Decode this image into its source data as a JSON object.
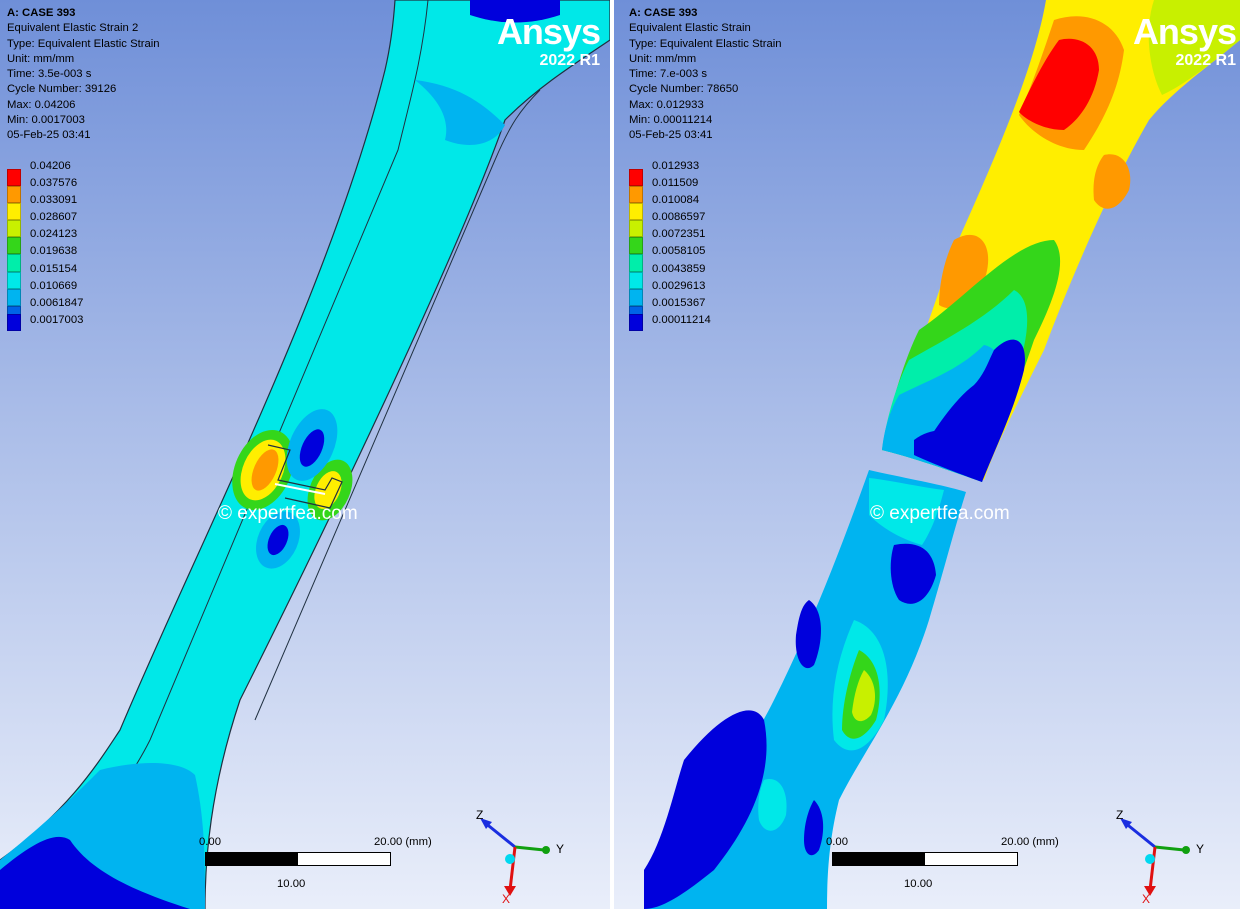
{
  "panels": [
    {
      "case": "A: CASE 393",
      "result_name": "Equivalent Elastic Strain 2",
      "type": "Type: Equivalent Elastic Strain",
      "unit": "Unit: mm/mm",
      "time": "Time: 3.5e-003 s",
      "cycle": "Cycle Number: 39126",
      "max": "Max: 0.04206",
      "min": "Min: 0.0017003",
      "date": "05-Feb-25 03:41",
      "legend": [
        "0.04206",
        "0.037576",
        "0.033091",
        "0.028607",
        "0.024123",
        "0.019638",
        "0.015154",
        "0.010669",
        "0.0061847",
        "0.0017003"
      ],
      "scale": {
        "left": "0.00",
        "right": "20.00 (mm)",
        "mid": "10.00"
      }
    },
    {
      "case": "A: CASE 393",
      "result_name": "Equivalent Elastic Strain",
      "type": "Type: Equivalent Elastic Strain",
      "unit": "Unit: mm/mm",
      "time": "Time: 7.e-003 s",
      "cycle": "Cycle Number: 78650",
      "max": "Max: 0.012933",
      "min": "Min: 0.00011214",
      "date": "05-Feb-25 03:41",
      "legend": [
        "0.012933",
        "0.011509",
        "0.010084",
        "0.0086597",
        "0.0072351",
        "0.0058105",
        "0.0043859",
        "0.0029613",
        "0.0015367",
        "0.00011214"
      ],
      "scale": {
        "left": "0.00",
        "right": "20.00 (mm)",
        "mid": "10.00"
      }
    }
  ],
  "legend_colors": [
    "#ff0000",
    "#ff9900",
    "#ffee00",
    "#c8f000",
    "#34d61a",
    "#00eeaa",
    "#00e8e8",
    "#00b4f0",
    "#0064e6",
    "#0000dc"
  ],
  "logo": {
    "word": "Ansys",
    "version": "2022 R1"
  },
  "watermark": "© expertfea.com",
  "triad": {
    "z": "Z",
    "y": "Y",
    "x": "X"
  },
  "triad_colors": {
    "z": "#1a2ee0",
    "y": "#10a010",
    "x": "#e01010",
    "center": "#00d8f0"
  }
}
